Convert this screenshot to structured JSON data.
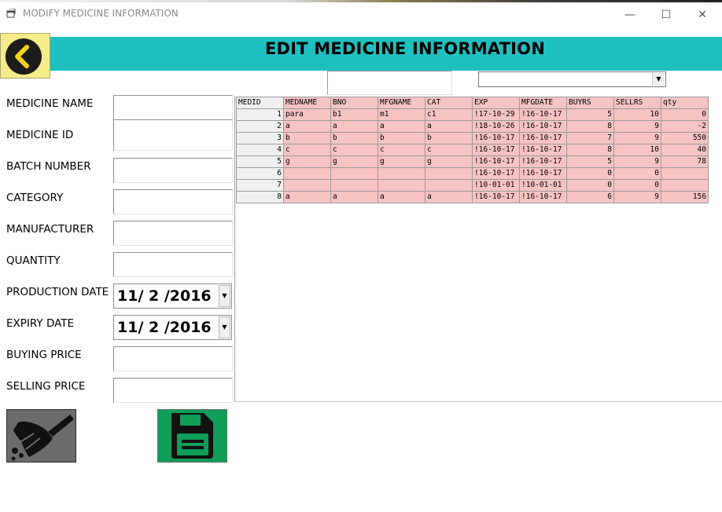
{
  "window": {
    "title": "MODIFY MEDICINE INFORMATION",
    "minimize_glyph": "—",
    "maximize_glyph": "☐",
    "close_glyph": "✕"
  },
  "header": {
    "title": "EDIT MEDICINE INFORMATION",
    "accent_color": "#1fbfbf",
    "back_icon": "chevron-left-circle-icon"
  },
  "search": {
    "value": "",
    "filter_value": ""
  },
  "form": {
    "fields": [
      {
        "label": "MEDICINE NAME",
        "value": ""
      },
      {
        "label": "MEDICINE ID",
        "value": ""
      },
      {
        "label": "BATCH NUMBER",
        "value": ""
      },
      {
        "label": "CATEGORY",
        "value": ""
      },
      {
        "label": "MANUFACTURER",
        "value": ""
      },
      {
        "label": "QUANTITY",
        "value": ""
      },
      {
        "label": "PRODUCTION DATE",
        "value": "11/ 2 /2016"
      },
      {
        "label": "EXPIRY DATE",
        "value": "11/ 2 /2016"
      },
      {
        "label": "BUYING PRICE",
        "value": ""
      },
      {
        "label": "SELLING PRICE",
        "value": ""
      }
    ]
  },
  "grid": {
    "columns": [
      "MEDID",
      "MEDNAME",
      "BNO",
      "MFGNAME",
      "CAT",
      "EXP",
      "MFGDATE",
      "BUYRS",
      "SELLRS",
      "qty"
    ],
    "rows": [
      [
        "1",
        "para",
        "b1",
        "m1",
        "c1",
        "!17-10-29",
        "!16-10-17",
        "5",
        "10",
        "0"
      ],
      [
        "2",
        "a",
        "a",
        "a",
        "a",
        "!18-10-26",
        "!16-10-17",
        "8",
        "9",
        "-2"
      ],
      [
        "3",
        "b",
        "b",
        "b",
        "b",
        "!16-10-17",
        "!16-10-17",
        "7",
        "9",
        "550"
      ],
      [
        "4",
        "c",
        "c",
        "c",
        "c",
        "!16-10-17",
        "!16-10-17",
        "8",
        "10",
        "40"
      ],
      [
        "5",
        "g",
        "g",
        "g",
        "g",
        "!16-10-17",
        "!16-10-17",
        "5",
        "9",
        "78"
      ],
      [
        "6",
        "",
        "",
        "",
        "",
        "!16-10-17",
        "!16-10-17",
        "0",
        "0",
        ""
      ],
      [
        "7",
        "",
        "",
        "",
        "",
        "!10-01-01",
        "!10-01-01",
        "0",
        "0",
        ""
      ],
      [
        "8",
        "a",
        "a",
        "a",
        "a",
        "!16-10-17",
        "!16-10-17",
        "6",
        "9",
        "156"
      ]
    ]
  },
  "buttons": {
    "clear_icon": "broom-icon",
    "save_icon": "floppy-disk-icon",
    "save_color": "#0f9d58"
  }
}
